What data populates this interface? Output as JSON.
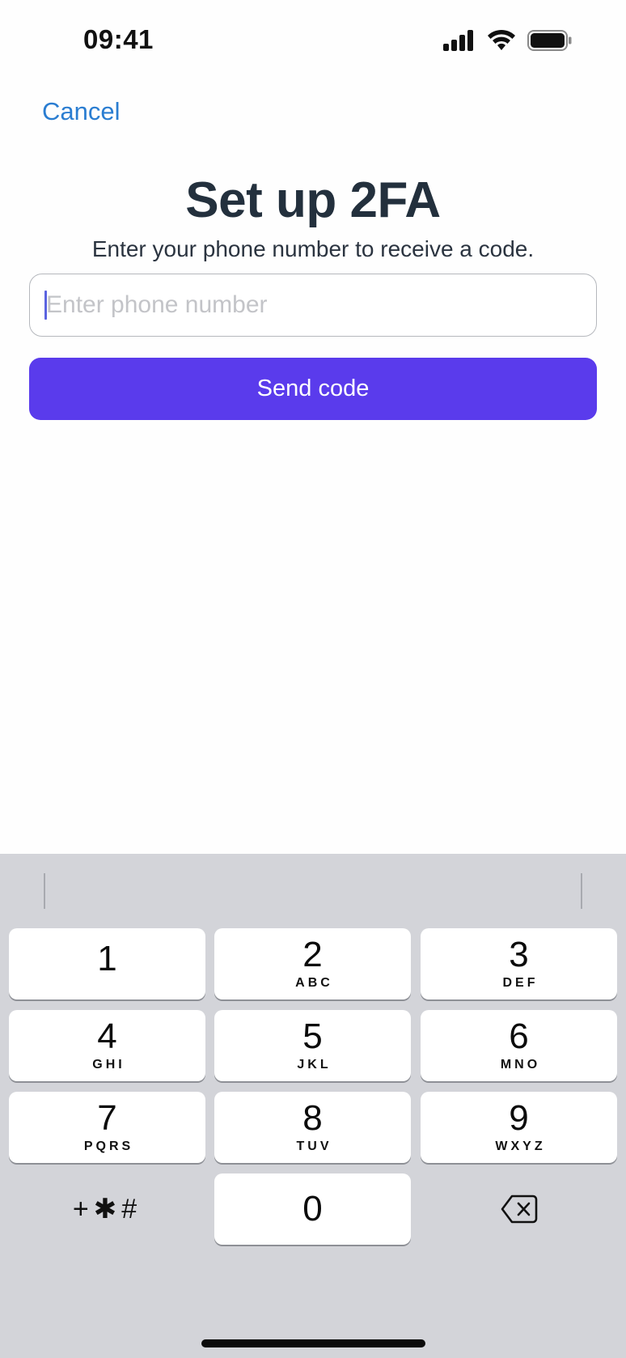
{
  "status_bar": {
    "time": "09:41"
  },
  "nav": {
    "cancel_label": "Cancel"
  },
  "header": {
    "title": "Set up 2FA",
    "subtitle": "Enter your phone number to receive a code."
  },
  "form": {
    "phone_value": "",
    "phone_placeholder": "Enter phone number",
    "send_label": "Send code"
  },
  "keypad": {
    "keys": [
      {
        "digit": "1",
        "letters": ""
      },
      {
        "digit": "2",
        "letters": "ABC"
      },
      {
        "digit": "3",
        "letters": "DEF"
      },
      {
        "digit": "4",
        "letters": "GHI"
      },
      {
        "digit": "5",
        "letters": "JKL"
      },
      {
        "digit": "6",
        "letters": "MNO"
      },
      {
        "digit": "7",
        "letters": "PQRS"
      },
      {
        "digit": "8",
        "letters": "TUV"
      },
      {
        "digit": "9",
        "letters": "WXYZ"
      },
      {
        "digit": "0",
        "letters": ""
      }
    ],
    "symbols_label": "+✱#",
    "delete_icon": "backspace-icon"
  },
  "colors": {
    "accent": "#5a3bec",
    "link": "#2a7dd1",
    "title": "#23303d",
    "keyboard_bg": "#d3d4d9"
  }
}
